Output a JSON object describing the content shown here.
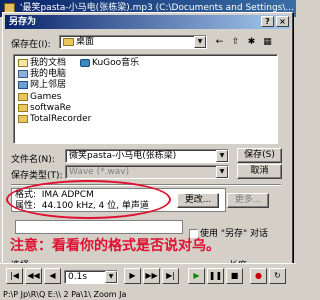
{
  "background_window": {
    "title": "'最笑pasta-小马电(张栋梁).mp3 (C:\\Documents and Settings\\..."
  },
  "dialog": {
    "title": "另存为",
    "help_button": "?",
    "close_button": "×",
    "save_in_label": "保存在(I):",
    "save_in_value": "桌面",
    "files": [
      {
        "name": "我的文档",
        "icon": "my-documents-icon"
      },
      {
        "name": "我的电脑",
        "icon": "my-computer-icon"
      },
      {
        "name": "网上邻居",
        "icon": "network-icon"
      },
      {
        "name": "Games",
        "icon": "folder-icon"
      },
      {
        "name": "softwaRe",
        "icon": "folder-icon"
      },
      {
        "name": "TotalRecorder",
        "icon": "folder-icon"
      },
      {
        "name": "KuGoo音乐",
        "icon": "kugoo-icon"
      }
    ],
    "filename_label": "文件名(N):",
    "filename_value": "微笑pasta-小马电(张栋梁)",
    "filetype_label": "保存类型(T):",
    "filetype_value": "Wave (*.wav)",
    "save_button": "保存(S)",
    "cancel_button": "取消",
    "format_label": "格式:",
    "format_value": "IMA ADPCM",
    "attr_label": "属性:",
    "attr_value": "44.100 kHz, 4 位, 单声道",
    "change_button": "更改...",
    "more_button": "更多...",
    "use_saveas_label": "使用 \"另存\" 对话",
    "select_label": "选择",
    "length_label": "长度:"
  },
  "annotation": "注意：看看你的格式是否说对乌。",
  "player": {
    "speed_value": "0.1s",
    "status_text": "P:\\P Jp\\R\\Q E:\\\\ 2 Pa\\1\\ Zoom Ja"
  },
  "colors": {
    "annotation": "#e01030",
    "titlebar": "#0a246a"
  }
}
